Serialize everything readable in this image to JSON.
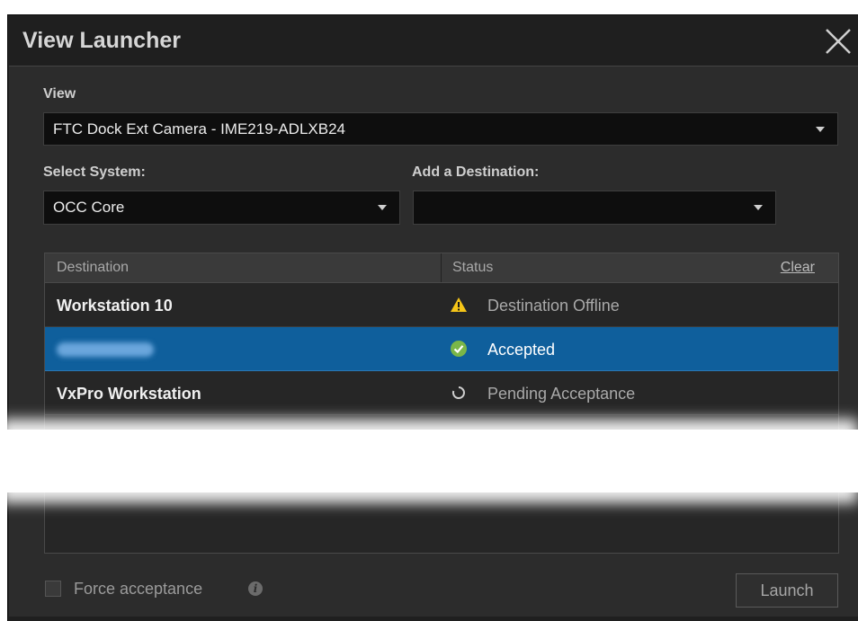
{
  "dialog": {
    "title": "View Launcher"
  },
  "view": {
    "label": "View",
    "selected": "FTC Dock Ext Camera - IME219-ADLXB24"
  },
  "system": {
    "label": "Select System:",
    "selected": "OCC Core"
  },
  "destination_picker": {
    "label": "Add a Destination:",
    "selected": ""
  },
  "table": {
    "headers": {
      "destination": "Destination",
      "status": "Status"
    },
    "clear_label": "Clear",
    "rows": [
      {
        "destination": "Workstation 10",
        "status": "Destination Offline",
        "status_icon": "warning-icon",
        "selected": false
      },
      {
        "destination": "",
        "status": "Accepted",
        "status_icon": "check-circle-icon",
        "selected": true
      },
      {
        "destination": "VxPro Workstation",
        "status": "Pending Acceptance",
        "status_icon": "spinner-icon",
        "selected": false
      }
    ]
  },
  "footer": {
    "force_label": "Force acceptance",
    "force_checked": false,
    "launch_label": "Launch"
  },
  "colors": {
    "selection": "#0f5f9c",
    "warning": "#f5c518",
    "accepted": "#7ab648"
  }
}
